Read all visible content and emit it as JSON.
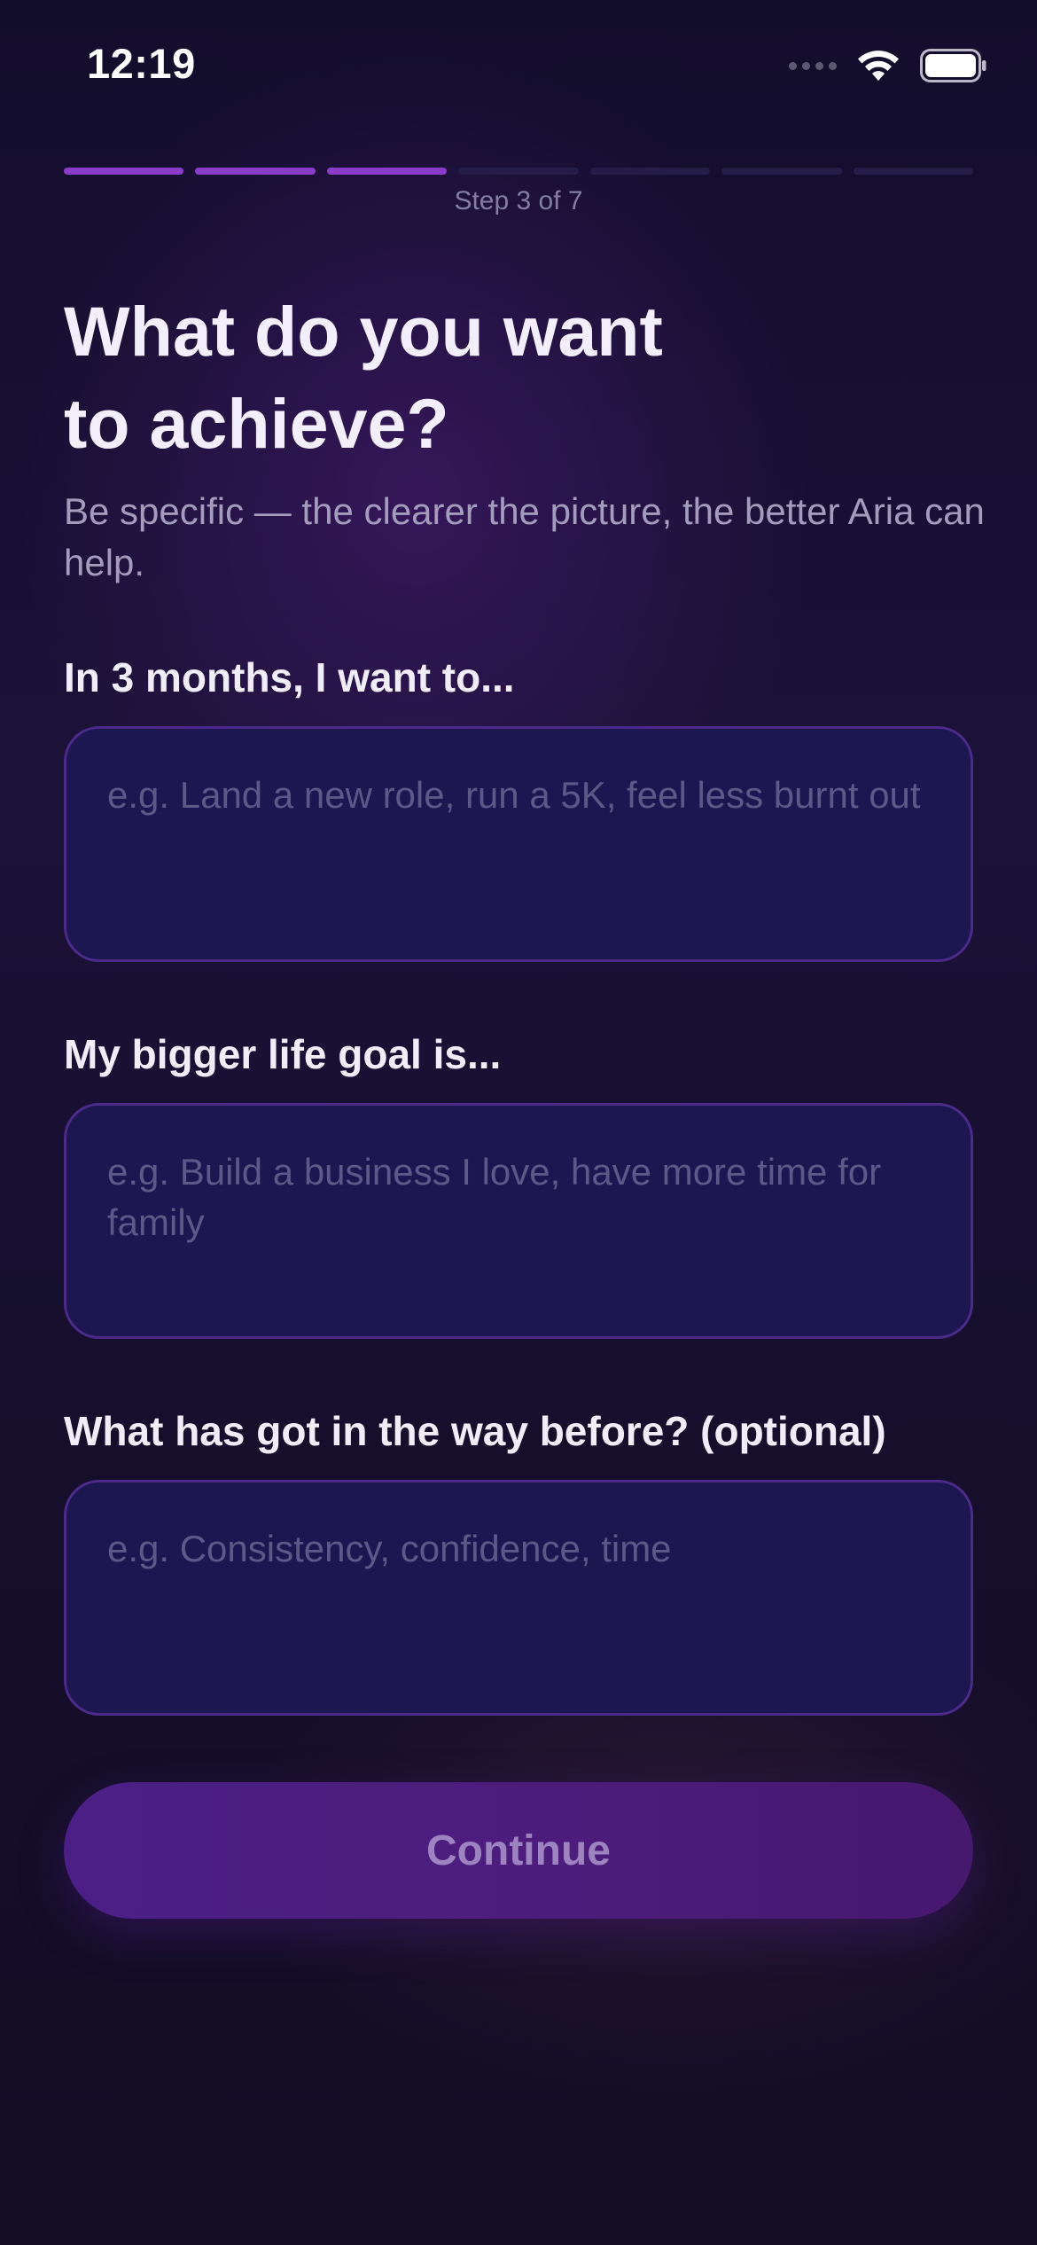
{
  "status_bar": {
    "time": "12:19",
    "icons": [
      "cellular-signal-icon",
      "wifi-icon",
      "battery-icon"
    ]
  },
  "progress": {
    "current_step": 3,
    "total_steps": 7,
    "label": "Step 3 of 7"
  },
  "header": {
    "title": "What do you want\nto achieve?",
    "subtitle": "Be specific — the clearer the picture, the better Aria can help."
  },
  "fields": [
    {
      "label": "In 3 months, I want to...",
      "value": "",
      "placeholder": "e.g. Land a new role, run a 5K, feel less burnt out"
    },
    {
      "label": "My bigger life goal is...",
      "value": "",
      "placeholder": "e.g. Build a business I love, have more time for family"
    },
    {
      "label": "What has got in the way before? (optional)",
      "value": "",
      "placeholder": "e.g. Consistency, confidence, time"
    }
  ],
  "continue_button": {
    "label": "Continue"
  },
  "colors": {
    "accent": "#8a3cc8",
    "progress_inactive": "#231d47",
    "field_background": "#1c1750",
    "field_border": "#4b2a8a",
    "button_background": "#4c1d7c",
    "button_text": "#9d84c0"
  }
}
